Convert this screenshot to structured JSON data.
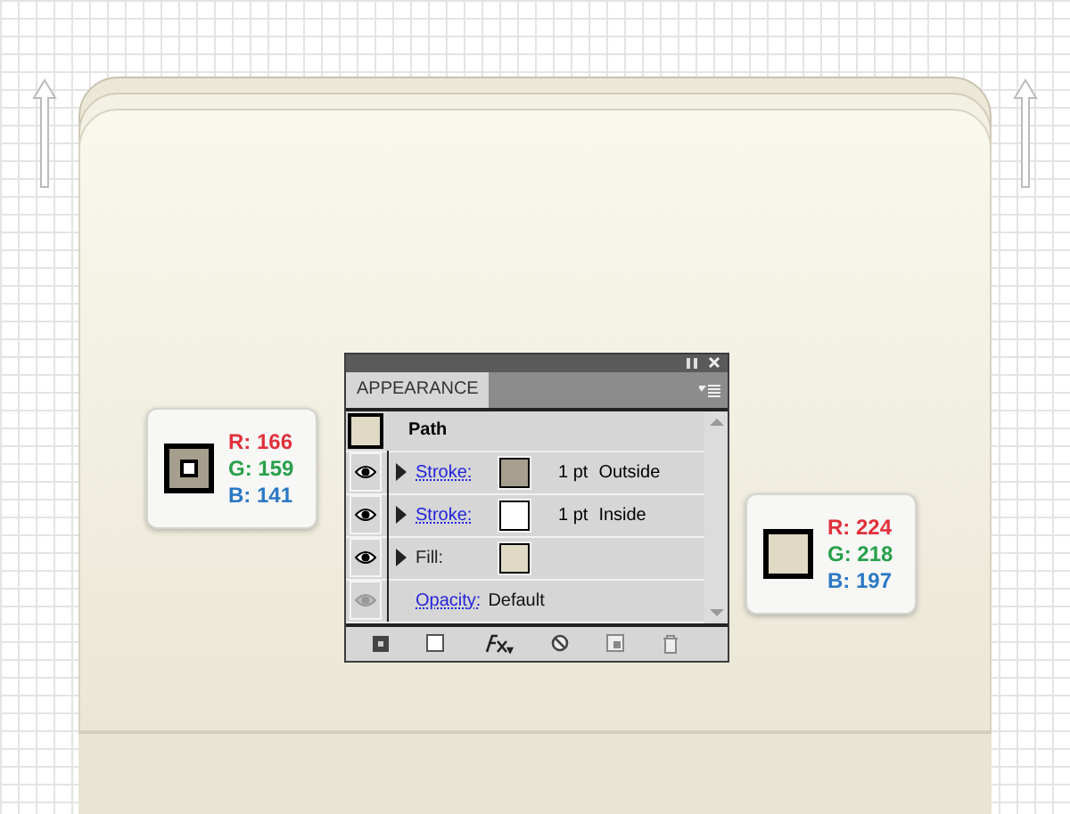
{
  "callouts": [
    {
      "kind": "stroke",
      "color": "#a69f8d",
      "r": "R: 166",
      "g": "G: 159",
      "b": "B: 141"
    },
    {
      "kind": "fill",
      "color": "#e0dac5",
      "r": "R: 224",
      "g": "G: 218",
      "b": "B: 197"
    }
  ],
  "panel": {
    "tab": "APPEARANCE",
    "object": {
      "label": "Path",
      "color": "#e0dac5"
    },
    "rows": [
      {
        "kind": "stroke",
        "label": "Stroke:",
        "color": "#a69f8d",
        "weight": "1 pt",
        "align": "Outside",
        "dimmed": false
      },
      {
        "kind": "stroke",
        "label": "Stroke:",
        "color": "#ffffff",
        "weight": "1 pt",
        "align": "Inside",
        "dimmed": false
      },
      {
        "kind": "fill",
        "label": "Fill:",
        "color": "#e0dac5",
        "dimmed": false
      },
      {
        "kind": "opacity",
        "label": "Opacity:",
        "value": "Default",
        "dimmed": true
      }
    ]
  }
}
